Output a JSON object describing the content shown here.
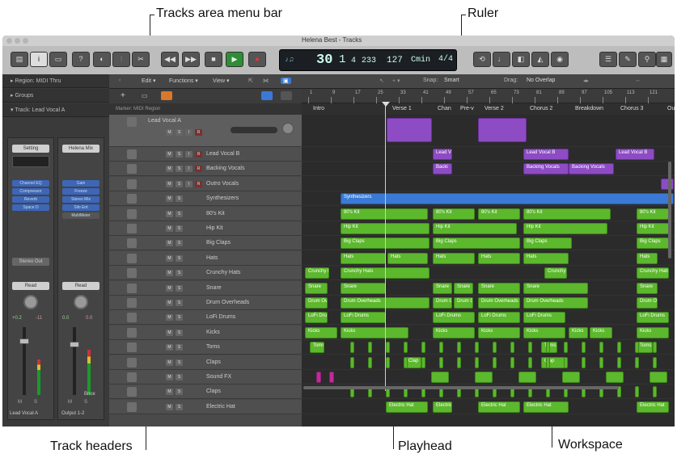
{
  "callouts": {
    "tracks_menu_bar": "Tracks area menu bar",
    "ruler": "Ruler",
    "track_headers": "Track headers",
    "playhead": "Playhead",
    "workspace": "Workspace"
  },
  "window": {
    "title": "Helena Best - Tracks"
  },
  "lcd": {
    "bar": "30",
    "beat": "1",
    "sub": "4",
    "tick": "233",
    "tempo": "127",
    "key": "Cmin",
    "sig": "4/4"
  },
  "inspector": {
    "region_row": "▸ Region: MIDI Thru",
    "groups_row": "▸ Groups",
    "track_row": "▾ Track: Lead Vocal A",
    "strip1": {
      "setting": "Setting",
      "plugins": [
        "Channel EQ",
        "Compressor",
        "Reverb",
        "Space D"
      ],
      "output": "Stereo Out",
      "mode": "Read",
      "vol": "+0.2",
      "pan": "-11",
      "name": "Lead Vocal A",
      "meters": [
        "M",
        "S"
      ]
    },
    "strip2": {
      "setting": "Helena Mix",
      "plugins": [
        "Gain",
        "Freeze",
        "Stereo Mix",
        "Silo Ent"
      ],
      "extra": "MultiMeter",
      "mode": "Read",
      "vol": "0.0",
      "pan": "0.0",
      "name": "Output 1-2",
      "meters": [
        "M",
        "S"
      ],
      "bounce": "Bnce"
    }
  },
  "tracks_menu": {
    "edit": "Edit ▾",
    "functions": "Functions ▾",
    "view": "View ▾"
  },
  "ruler_menu": {
    "snap_label": "Snap:",
    "snap_value": "Smart",
    "drag_label": "Drag:",
    "drag_value": "No Overlap"
  },
  "marker_row": "Marker: MIDI Region",
  "tracks": [
    {
      "name": "Lead Vocal A",
      "selected": true
    },
    {
      "name": "Lead Vocal B"
    },
    {
      "name": "Backing Vocals"
    },
    {
      "name": "Outro Vocals"
    },
    {
      "name": "Synthesizers"
    },
    {
      "name": "80's Kit"
    },
    {
      "name": "Hip Kit"
    },
    {
      "name": "Big Claps"
    },
    {
      "name": "Hats"
    },
    {
      "name": "Crunchy Hats"
    },
    {
      "name": "Snare"
    },
    {
      "name": "Drum Overheads"
    },
    {
      "name": "LoFi Drums"
    },
    {
      "name": "Kicks"
    },
    {
      "name": "Toms"
    },
    {
      "name": "Claps"
    },
    {
      "name": "Sound FX"
    },
    {
      "name": "Claps"
    },
    {
      "name": "Electric Hat"
    }
  ],
  "ruler_ticks": [
    "1",
    "9",
    "17",
    "25",
    "33",
    "41",
    "49",
    "57",
    "65",
    "73",
    "81",
    "89",
    "97",
    "105",
    "113",
    "121"
  ],
  "markers": [
    "Intro",
    "Verse 1",
    "Chan",
    "Pre-v",
    "Verse 2",
    "Chorus 2",
    "Breakdown",
    "Chorus 3",
    "Out"
  ],
  "region_labels": {
    "lead_v": "Lead V",
    "lead_vocal_b": "Lead Vocal B",
    "backing": "Backing Vocals",
    "backi": "Backi",
    "synth": "Synthesizers",
    "kit": "80's Kit",
    "hip": "Hip Kit",
    "claps": "Big Claps",
    "hats": "Hats",
    "crunchy": "Crunchy Hats",
    "snare": "Snare",
    "overheads": "Drum Overheads",
    "lofi": "LoFi Drums",
    "kicks": "Kicks",
    "toms": "Toms",
    "clap": "Clap",
    "ehat": "Electric Hat"
  },
  "colors": {
    "audio": "#5cb82c",
    "vocal": "#8d4bc4",
    "synth": "#3a7ad6",
    "fx": "#c12a9a"
  }
}
